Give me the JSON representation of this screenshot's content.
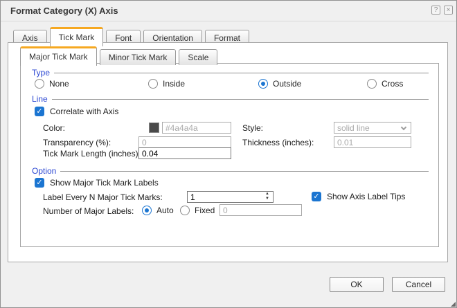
{
  "dialog": {
    "title": "Format Category (X) Axis"
  },
  "titlebar": {
    "help_glyph": "?",
    "close_glyph": "×"
  },
  "tabs": [
    {
      "label": "Axis",
      "active": false
    },
    {
      "label": "Tick Mark",
      "active": true
    },
    {
      "label": "Font",
      "active": false
    },
    {
      "label": "Orientation",
      "active": false
    },
    {
      "label": "Format",
      "active": false
    }
  ],
  "subtabs": [
    {
      "label": "Major Tick Mark",
      "active": true
    },
    {
      "label": "Minor Tick Mark",
      "active": false
    },
    {
      "label": "Scale",
      "active": false
    }
  ],
  "type_group": {
    "label": "Type",
    "options": [
      {
        "label": "None",
        "selected": false
      },
      {
        "label": "Inside",
        "selected": false
      },
      {
        "label": "Outside",
        "selected": true
      },
      {
        "label": "Cross",
        "selected": false
      }
    ]
  },
  "line_group": {
    "label": "Line",
    "correlate_checkbox": {
      "label": "Correlate with Axis",
      "checked": true,
      "check_glyph": "✓"
    },
    "color": {
      "label": "Color:",
      "swatch_hex": "#4a4a4a",
      "value": "#4a4a4a",
      "disabled": true
    },
    "style": {
      "label": "Style:",
      "value": "solid line",
      "disabled": true
    },
    "transparency": {
      "label": "Transparency (%):",
      "value": "0",
      "disabled": true
    },
    "thickness": {
      "label": "Thickness (inches):",
      "value": "0.01",
      "disabled": true
    },
    "tick_length": {
      "label": "Tick Mark Length (inches):",
      "value": "0.04",
      "disabled": false
    }
  },
  "option_group": {
    "label": "Option",
    "show_labels_checkbox": {
      "label": "Show Major Tick Mark Labels",
      "checked": true,
      "check_glyph": "✓"
    },
    "label_every_n": {
      "label": "Label Every N Major Tick Marks:",
      "value": "1",
      "spin_up": "▲",
      "spin_down": "▼"
    },
    "show_tips_checkbox": {
      "label": "Show Axis Label Tips",
      "checked": true,
      "check_glyph": "✓"
    },
    "num_major_labels": {
      "label": "Number of Major Labels:",
      "auto": {
        "label": "Auto",
        "selected": true
      },
      "fixed": {
        "label": "Fixed",
        "selected": false
      },
      "fixed_value": "0",
      "fixed_disabled": true
    }
  },
  "buttons": {
    "ok": "OK",
    "cancel": "Cancel"
  },
  "colors": {
    "accent_blue": "#1b75d1",
    "group_label_blue": "#2a46d2",
    "active_tab_orange": "#f6a821",
    "swatch": "#4a4a4a",
    "dialog_bg": "#f0f0f0"
  }
}
